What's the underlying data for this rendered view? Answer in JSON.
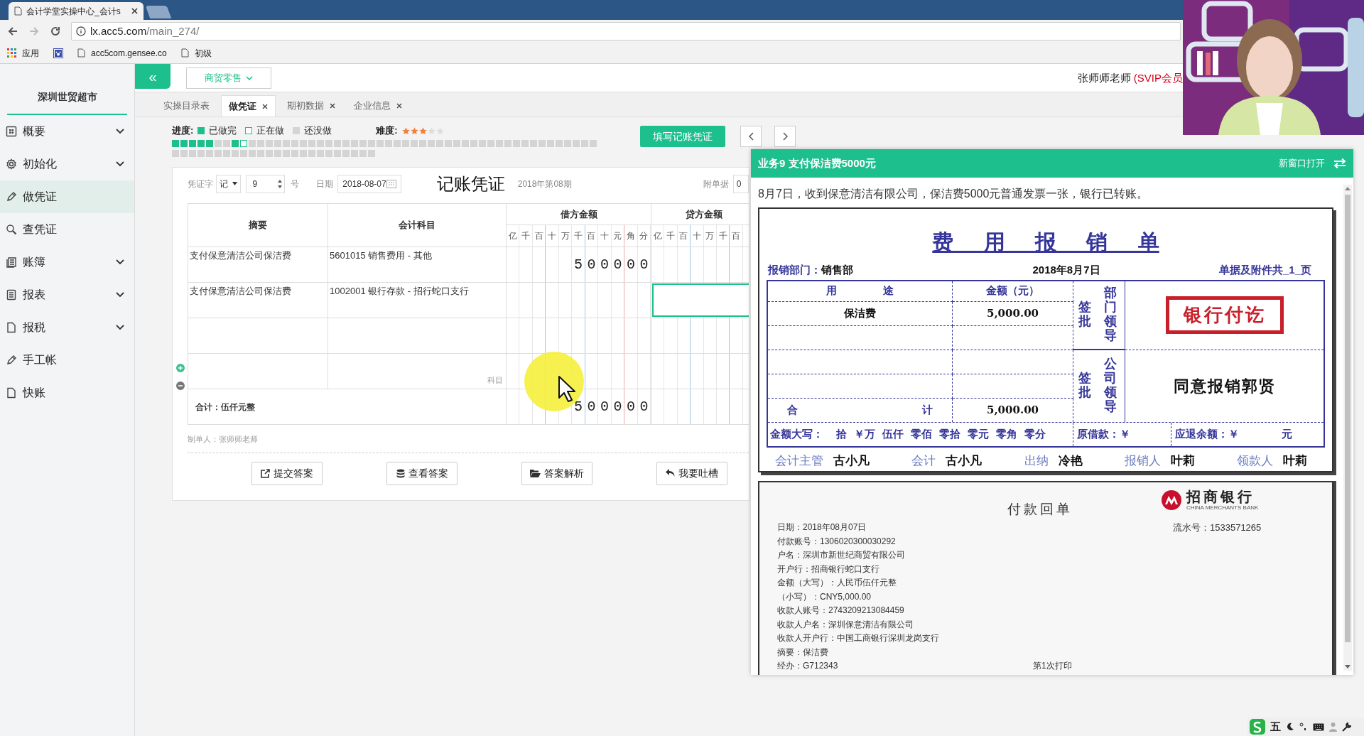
{
  "browser": {
    "tab_title": "会计学堂实操中心_会计s",
    "url_host": "lx.acc5.com",
    "url_path": "/main_274/",
    "bookmarks": [
      {
        "kind": "apps",
        "label": "应用"
      },
      {
        "kind": "paw"
      },
      {
        "kind": "page",
        "label": "acc5com.gensee.co"
      },
      {
        "kind": "page",
        "label": "初级"
      }
    ]
  },
  "sidebar": {
    "company": "深圳世贸超市",
    "items": [
      {
        "kind": "grid",
        "label": "概要",
        "expandable": true,
        "selected": false
      },
      {
        "kind": "gear",
        "label": "初始化",
        "expandable": true,
        "selected": false
      },
      {
        "kind": "pencil",
        "label": "做凭证",
        "expandable": false,
        "selected": true
      },
      {
        "kind": "search",
        "label": "查凭证",
        "expandable": false,
        "selected": false
      },
      {
        "kind": "book",
        "label": "账簿",
        "expandable": true,
        "selected": false
      },
      {
        "kind": "list",
        "label": "报表",
        "expandable": true,
        "selected": false
      },
      {
        "kind": "file",
        "label": "报税",
        "expandable": true,
        "selected": false
      },
      {
        "kind": "pencil",
        "label": "手工帐",
        "expandable": false,
        "selected": false
      },
      {
        "kind": "file",
        "label": "快账",
        "expandable": false,
        "selected": false
      }
    ]
  },
  "header": {
    "collapse_button": "«",
    "industry": "商贸零售",
    "user": "张师师老师",
    "member": "(SVIP会员"
  },
  "tabs": [
    {
      "label": "实操目录表",
      "closable": false,
      "selected": false
    },
    {
      "label": "做凭证",
      "closable": true,
      "selected": true
    },
    {
      "label": "期初数据",
      "closable": true,
      "selected": false
    },
    {
      "label": "企业信息",
      "closable": true,
      "selected": false
    }
  ],
  "progress": {
    "label": "进度:",
    "legend": [
      {
        "kind": "done",
        "label": "已做完"
      },
      {
        "kind": "current",
        "label": "正在做"
      },
      {
        "kind": "todo",
        "label": "还没做"
      }
    ],
    "difficulty_label": "难度:",
    "stars": 3,
    "cell_rows": [
      [
        {
          "kind": "done"
        },
        {
          "kind": "done"
        },
        {
          "kind": "done"
        },
        {
          "kind": "done"
        },
        {
          "kind": "done"
        },
        {
          "kind": "todo"
        },
        {
          "kind": "todo"
        },
        {
          "kind": "done"
        },
        {
          "kind": "current"
        },
        {
          "kind": "todo"
        },
        {
          "kind": "todo"
        },
        {
          "kind": "todo"
        },
        {
          "kind": "todo"
        },
        {
          "kind": "todo"
        },
        {
          "kind": "todo"
        },
        {
          "kind": "todo"
        },
        {
          "kind": "todo"
        },
        {
          "kind": "todo"
        },
        {
          "kind": "todo"
        },
        {
          "kind": "todo"
        },
        {
          "kind": "todo"
        },
        {
          "kind": "todo"
        },
        {
          "kind": "todo"
        },
        {
          "kind": "todo"
        },
        {
          "kind": "todo"
        },
        {
          "kind": "todo"
        },
        {
          "kind": "todo"
        },
        {
          "kind": "todo"
        },
        {
          "kind": "todo"
        },
        {
          "kind": "todo"
        },
        {
          "kind": "todo"
        },
        {
          "kind": "todo"
        },
        {
          "kind": "todo"
        },
        {
          "kind": "todo"
        },
        {
          "kind": "todo"
        },
        {
          "kind": "todo"
        },
        {
          "kind": "todo"
        },
        {
          "kind": "todo"
        },
        {
          "kind": "todo"
        },
        {
          "kind": "todo"
        },
        {
          "kind": "todo"
        },
        {
          "kind": "todo"
        },
        {
          "kind": "todo"
        },
        {
          "kind": "todo"
        },
        {
          "kind": "todo"
        },
        {
          "kind": "todo"
        },
        {
          "kind": "todo"
        },
        {
          "kind": "todo"
        },
        {
          "kind": "todo"
        },
        {
          "kind": "todo"
        }
      ],
      [
        {
          "kind": "todo"
        },
        {
          "kind": "todo"
        },
        {
          "kind": "todo"
        },
        {
          "kind": "todo"
        },
        {
          "kind": "todo"
        },
        {
          "kind": "todo"
        },
        {
          "kind": "todo"
        },
        {
          "kind": "todo"
        },
        {
          "kind": "todo"
        },
        {
          "kind": "todo"
        },
        {
          "kind": "todo"
        },
        {
          "kind": "todo"
        },
        {
          "kind": "todo"
        },
        {
          "kind": "todo"
        },
        {
          "kind": "todo"
        },
        {
          "kind": "todo"
        },
        {
          "kind": "todo"
        },
        {
          "kind": "todo"
        },
        {
          "kind": "todo"
        },
        {
          "kind": "todo"
        },
        {
          "kind": "todo"
        },
        {
          "kind": "todo"
        },
        {
          "kind": "todo"
        },
        {
          "kind": "todo"
        }
      ]
    ]
  },
  "fill_button": "填写记账凭证",
  "voucher": {
    "word_label": "凭证字",
    "word": "记",
    "number": "9",
    "number_suffix": "号",
    "date_label": "日期",
    "date": "2018-08-07",
    "title": "记账凭证",
    "period": "2018年第08期",
    "attachments_label": "附单据",
    "attachments": "0",
    "columns": {
      "summary": "摘要",
      "account": "会计科目",
      "debit": "借方金额",
      "credit": "贷方金额"
    },
    "debit_units": [
      "亿",
      "千",
      "百",
      "十",
      "万",
      "千",
      "百",
      "十",
      "元",
      "角",
      "分"
    ],
    "credit_units": [
      "亿",
      "千",
      "百",
      "十",
      "万",
      "千",
      "百"
    ],
    "rows": [
      {
        "summary": "支付保意清洁公司保洁费",
        "account": "5601015 销售费用 - 其他",
        "debit_digits": "500000",
        "editing": false
      },
      {
        "summary": "支付保意清洁公司保洁费",
        "account": "1002001 银行存款 - 招行蛇口支行",
        "editing": true
      },
      {
        "editing": false
      },
      {
        "account_placeholder": "科目",
        "editing": false
      }
    ],
    "total": {
      "label": "合计：伍仟元整",
      "debit_digits": "500000"
    },
    "maker": "制单人：张师师老师",
    "actions": [
      {
        "kind": "submit",
        "label": "提交答案"
      },
      {
        "kind": "answer",
        "label": "查看答案"
      },
      {
        "kind": "analysis",
        "label": "答案解析"
      },
      {
        "kind": "feedback",
        "label": "我要吐槽"
      }
    ]
  },
  "task_panel": {
    "title": "业务9 支付保洁费5000元",
    "open_new": "新窗口打开",
    "description": "8月7日，收到保意清洁有限公司，保洁费5000元普通发票一张，银行已转账。",
    "expense_form": {
      "title": "费 用 报 销 单",
      "dept_label": "报销部门：",
      "dept": "销售部",
      "date": "2018年8月7日",
      "attachments": "单据及附件共_1_页",
      "purpose_header": "用 途",
      "amount_header": "金额（元）",
      "lines": [
        {
          "purpose": "保洁费",
          "amount": "5,000.00"
        }
      ],
      "total_label": "合 计",
      "total": "5,000.00",
      "dept_sign": {
        "side": "签批",
        "head": "部门领导"
      },
      "company_sign": {
        "side": "签批",
        "head": "公司领导"
      },
      "stamp": "银行付讫",
      "approval": "同意报销郭贤",
      "capital_label": "金额大写：",
      "capital_parts": [
        "拾",
        "￥万",
        "伍仟",
        "零佰",
        "零拾",
        "零元",
        "零角",
        "零分"
      ],
      "loan": "原借款：￥",
      "refund": "应退余额：￥",
      "refund_unit": "元",
      "signatures": [
        {
          "role": "会计主管",
          "name": "古小凡"
        },
        {
          "role": "会计",
          "name": "古小凡"
        },
        {
          "role": "出纳",
          "name": "冷艳"
        },
        {
          "role": "报销人",
          "name": "叶莉"
        },
        {
          "role": "领款人",
          "name": "叶莉"
        }
      ]
    },
    "bank_receipt": {
      "title": "付款回单",
      "bank": "招商银行",
      "bank_en": "CHINA MERCHANTS BANK",
      "serial": "流水号：1533571265",
      "lines": [
        "日期：2018年08月07日",
        "付款账号：1306020300030292",
        "户名：深圳市新世纪商贸有限公司",
        "开户行：招商银行蛇口支行",
        "金额（大写）：人民币伍仟元整",
        "（小写）：CNY5,000.00",
        "收款人账号：2743209213084459",
        "收款人户名：深圳保意清洁有限公司",
        "收款人开户行：中国工商银行深圳龙岗支行",
        "摘要：保洁费",
        "经办：G712343"
      ],
      "print_count": "第1次打印"
    }
  },
  "ime": {
    "mode": "五"
  }
}
